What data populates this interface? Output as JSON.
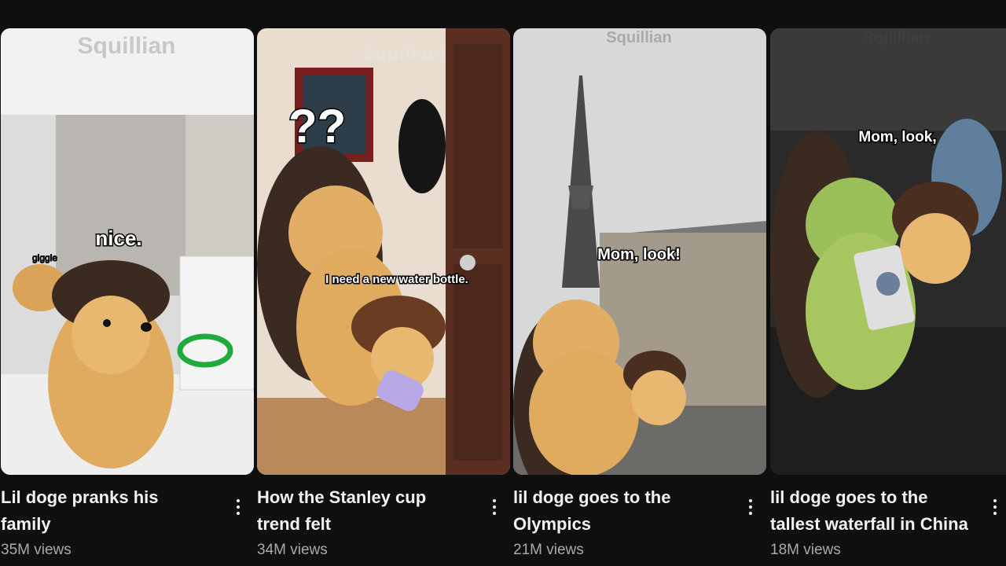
{
  "colors": {
    "background": "#0f0f0f",
    "title": "#f1f1f1",
    "meta": "#aaaaaa"
  },
  "shorts": [
    {
      "title": "Lil doge pranks his family",
      "views": "35M views",
      "watermark": "Squillian",
      "caption": "nice.",
      "corner_text": "giggie",
      "menu_icon": "more-vert-icon"
    },
    {
      "title": "How the Stanley cup trend felt",
      "views": "34M views",
      "watermark": "Squillian",
      "caption": "I need a new water bottle.",
      "marks": "??",
      "menu_icon": "more-vert-icon"
    },
    {
      "title": "lil doge goes to the Olympics",
      "views": "21M views",
      "watermark": "Squillian",
      "caption": "Mom, look!",
      "menu_icon": "more-vert-icon"
    },
    {
      "title": "lil doge goes to the tallest waterfall in China",
      "views": "18M views",
      "watermark": "Squillian",
      "caption": "Mom, look,",
      "menu_icon": "more-vert-icon"
    }
  ]
}
